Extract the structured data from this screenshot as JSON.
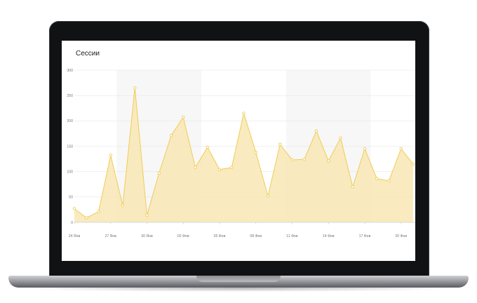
{
  "chart_data": {
    "type": "area",
    "title": "Сессии",
    "xlabel": "",
    "ylabel": "",
    "ylim": [
      0,
      300
    ],
    "yticks": [
      0,
      50,
      100,
      150,
      200,
      250,
      300
    ],
    "xticks": [
      {
        "index": 0,
        "label": "24 Янв"
      },
      {
        "index": 3,
        "label": "27 Янв"
      },
      {
        "index": 6,
        "label": "30 Янв"
      },
      {
        "index": 9,
        "label": "02 Фев"
      },
      {
        "index": 12,
        "label": "05 Фев"
      },
      {
        "index": 15,
        "label": "08 Фев"
      },
      {
        "index": 18,
        "label": "11 Фев"
      },
      {
        "index": 21,
        "label": "14 Фев"
      },
      {
        "index": 24,
        "label": "17 Фев"
      },
      {
        "index": 27,
        "label": "20 Фев"
      }
    ],
    "values": [
      27,
      9,
      21,
      132,
      33,
      265,
      14,
      97,
      171,
      207,
      108,
      148,
      104,
      108,
      215,
      138,
      52,
      154,
      123,
      124,
      180,
      121,
      166,
      70,
      145,
      86,
      82,
      145,
      115
    ],
    "grid": true,
    "colors": {
      "line": "#f0cc55",
      "fill": "#f8e8b4",
      "point": "#ffffff",
      "band": "#f7f7f7",
      "grid": "#e6e6e6"
    }
  }
}
